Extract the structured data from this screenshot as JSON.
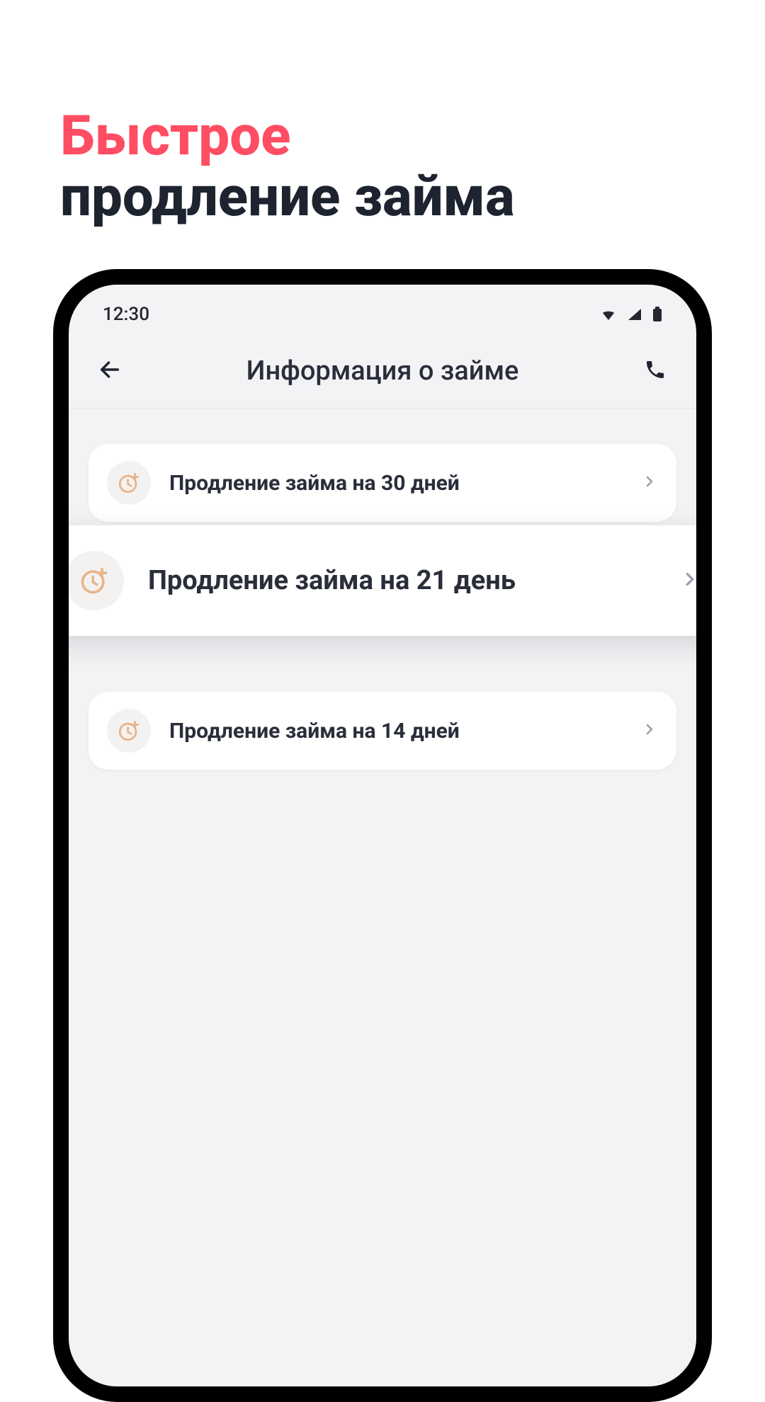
{
  "promo": {
    "line1": "Быстрое",
    "line2": "продление займа"
  },
  "statusbar": {
    "time": "12:30"
  },
  "header": {
    "title": "Информация о займе"
  },
  "options": [
    {
      "label": "Продление займа на 30 дней"
    },
    {
      "label": "Продление займа на 21 день"
    },
    {
      "label": "Продление займа на 14 дней"
    }
  ]
}
